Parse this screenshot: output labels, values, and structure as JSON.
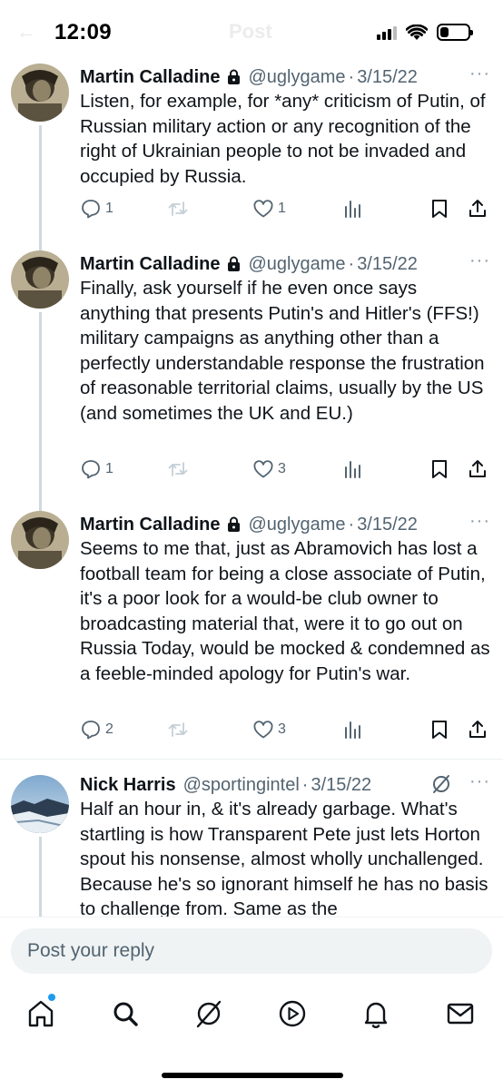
{
  "status_bar": {
    "time": "12:09"
  },
  "header": {
    "back_label": "←",
    "title": "Post"
  },
  "tweets": [
    {
      "author": "Martin Calladine",
      "handle": "@uglygame",
      "date": "3/15/22",
      "text": "Listen, for example, for *any* criticism of Putin, of Russian military action or any recognition of the right of Ukrainian people to not be invaded and occupied by Russia.",
      "replies": "1",
      "reposts": "",
      "likes": "1",
      "more": "···"
    },
    {
      "author": "Martin Calladine",
      "handle": "@uglygame",
      "date": "3/15/22",
      "text": "Finally, ask yourself if he even once says anything that presents Putin's and Hitler's (FFS!) military campaigns as anything other than a perfectly understandable response the frustration of reasonable territorial claims, usually by the US (and sometimes the UK and EU.)",
      "replies": "1",
      "reposts": "",
      "likes": "3",
      "more": "···"
    },
    {
      "author": "Martin Calladine",
      "handle": "@uglygame",
      "date": "3/15/22",
      "text": "Seems to me that, just as Abramovich has lost a football team for being a close associate of Putin, it's a poor look for a would-be club owner to broadcasting material that, were it to go out on Russia Today, would be mocked & condemned as a feeble-minded apology for Putin's war.",
      "replies": "2",
      "reposts": "",
      "likes": "3",
      "more": "···"
    },
    {
      "author": "Nick Harris",
      "handle": "@sportingintel",
      "date": "3/15/22",
      "text": "Half an hour in, & it's already garbage. What's startling is how Transparent Pete just lets Horton spout his nonsense, almost wholly unchallenged. Because he's so ignorant himself he has no basis to challenge from. Same as the",
      "more": "···"
    }
  ],
  "separator": "·",
  "reply_bar": {
    "placeholder": "Post your reply"
  },
  "nav": [
    "home-icon",
    "search-icon",
    "grok-icon",
    "video-icon",
    "notifications-icon",
    "messages-icon"
  ],
  "colors": {
    "text": "#0f1419",
    "muted": "#536471",
    "accent": "#1d9bf0",
    "thread_line": "#cfd9de",
    "reply_bg": "#eff3f4"
  }
}
